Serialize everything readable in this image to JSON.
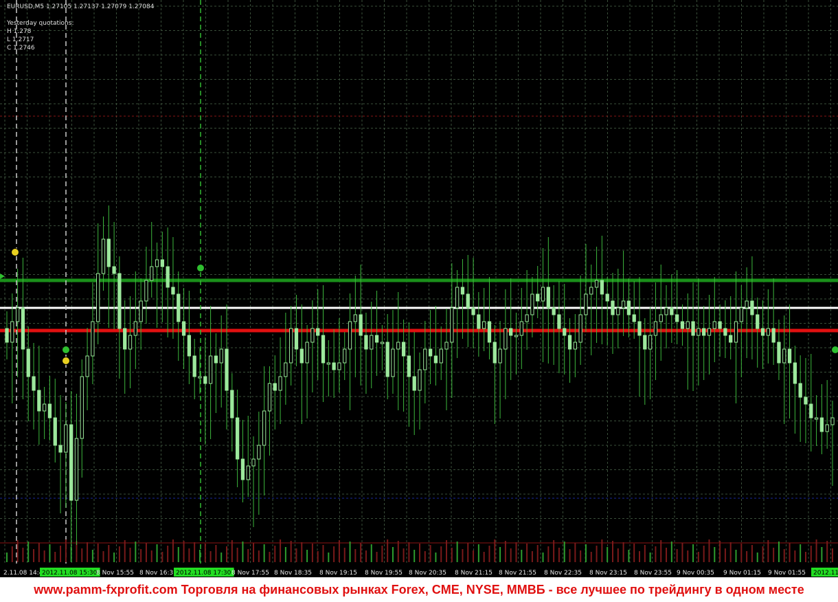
{
  "header": {
    "symbol_line": "EURUSD,M5  1.27105 1.27137 1.27079 1.27084",
    "yesterday_title": "Yesterday quotations:",
    "yesterday_high": "H 1.278",
    "yesterday_low": "L 1.2717",
    "yesterday_close": "C 1.2746"
  },
  "footer": {
    "text": "www.pamm-fxprofit.com Торговля на финансовых рынках Forex, CME, NYSE, ММВБ - все лучшее по трейдингу в одном месте"
  },
  "colors": {
    "background": "#000000",
    "grid": "#3a4f3a",
    "candle": "#9ce89c",
    "wick": "#3db83d",
    "resistance_line": "#1a8f1a",
    "pivot_line": "#ffffff",
    "support_line": "#e01010",
    "axis_highlight": "#22dd22",
    "footer_text": "#e01010"
  },
  "chart_data": {
    "type": "candlestick",
    "symbol": "EURUSD",
    "timeframe": "M5",
    "x_tick_labels": [
      "2.11.08 14:4",
      "2012.11.08 15:30",
      "8 Nov 15:55",
      "8 Nov 16:3",
      "2012.11.08 17:30",
      "8 Nov 17:55",
      "8 Nov 18:35",
      "8 Nov 19:15",
      "8 Nov 19:55",
      "8 Nov 20:35",
      "8 Nov 21:15",
      "8 Nov 21:55",
      "8 Nov 22:35",
      "8 Nov 23:15",
      "8 Nov 23:55",
      "9 Nov 00:35",
      "9 Nov 01:15",
      "9 Nov 01:55",
      "2012.11"
    ],
    "x_tick_highlight": [
      false,
      true,
      false,
      false,
      true,
      false,
      false,
      false,
      false,
      false,
      false,
      false,
      false,
      false,
      false,
      false,
      false,
      false,
      true
    ],
    "horizontal_lines": [
      {
        "name": "resistance",
        "color": "#1a8f1a",
        "y_level": 0.4
      },
      {
        "name": "pivot",
        "color": "#ffffff",
        "y_level": 0.0
      },
      {
        "name": "support",
        "color": "#e01010",
        "y_level": -0.33
      }
    ],
    "vertical_markers": [
      "2012.11.08 14:4",
      "2012.11.08 15:30",
      "2012.11.08 17:30"
    ],
    "closes": [
      -0.5,
      -0.2,
      0.0,
      -0.6,
      -1.0,
      -1.2,
      -1.5,
      -1.4,
      -1.6,
      -2.0,
      -2.1,
      -1.7,
      -2.8,
      -1.9,
      -1.0,
      -0.7,
      -0.2,
      0.5,
      1.0,
      0.6,
      0.5,
      -0.3,
      -0.6,
      -0.4,
      -0.2,
      0.1,
      0.4,
      0.6,
      0.7,
      0.6,
      0.3,
      0.2,
      -0.2,
      -0.4,
      -0.7,
      -1.0,
      -1.0,
      -1.1,
      -0.7,
      -0.8,
      -0.6,
      -1.2,
      -1.6,
      -2.2,
      -2.5,
      -2.3,
      -2.2,
      -2.0,
      -1.5,
      -1.1,
      -1.2,
      -1.0,
      -0.8,
      -0.3,
      -0.6,
      -0.8,
      -0.5,
      -0.3,
      -0.4,
      -0.8,
      -0.8,
      -0.9,
      -0.8,
      -0.6,
      -0.2,
      -0.1,
      -0.4,
      -0.6,
      -0.4,
      -0.5,
      -0.5,
      -1.0,
      -0.6,
      -0.5,
      -0.7,
      -1.0,
      -1.2,
      -0.9,
      -0.6,
      -0.7,
      -0.8,
      -0.6,
      -0.5,
      0.0,
      0.3,
      0.2,
      0.0,
      -0.1,
      -0.3,
      -0.2,
      -0.5,
      -0.8,
      -0.6,
      -0.3,
      -0.4,
      -0.4,
      -0.2,
      -0.1,
      0.2,
      0.1,
      0.3,
      0.0,
      -0.1,
      -0.3,
      -0.4,
      -0.6,
      -0.5,
      -0.1,
      0.2,
      0.3,
      0.4,
      0.2,
      0.1,
      -0.1,
      0.0,
      0.1,
      -0.1,
      -0.2,
      -0.4,
      -0.6,
      -0.4,
      -0.2,
      -0.1,
      0.0,
      -0.1,
      -0.2,
      -0.3,
      -0.2,
      -0.4,
      -0.3,
      -0.4,
      -0.3,
      -0.2,
      -0.3,
      -0.4,
      -0.5,
      -0.2,
      0.0,
      0.1,
      -0.1,
      -0.3,
      -0.4,
      -0.3,
      -0.5,
      -0.8,
      -0.6,
      -0.8,
      -1.1,
      -1.3,
      -1.4,
      -1.6,
      -1.6,
      -1.8,
      -1.7,
      -1.6
    ]
  }
}
